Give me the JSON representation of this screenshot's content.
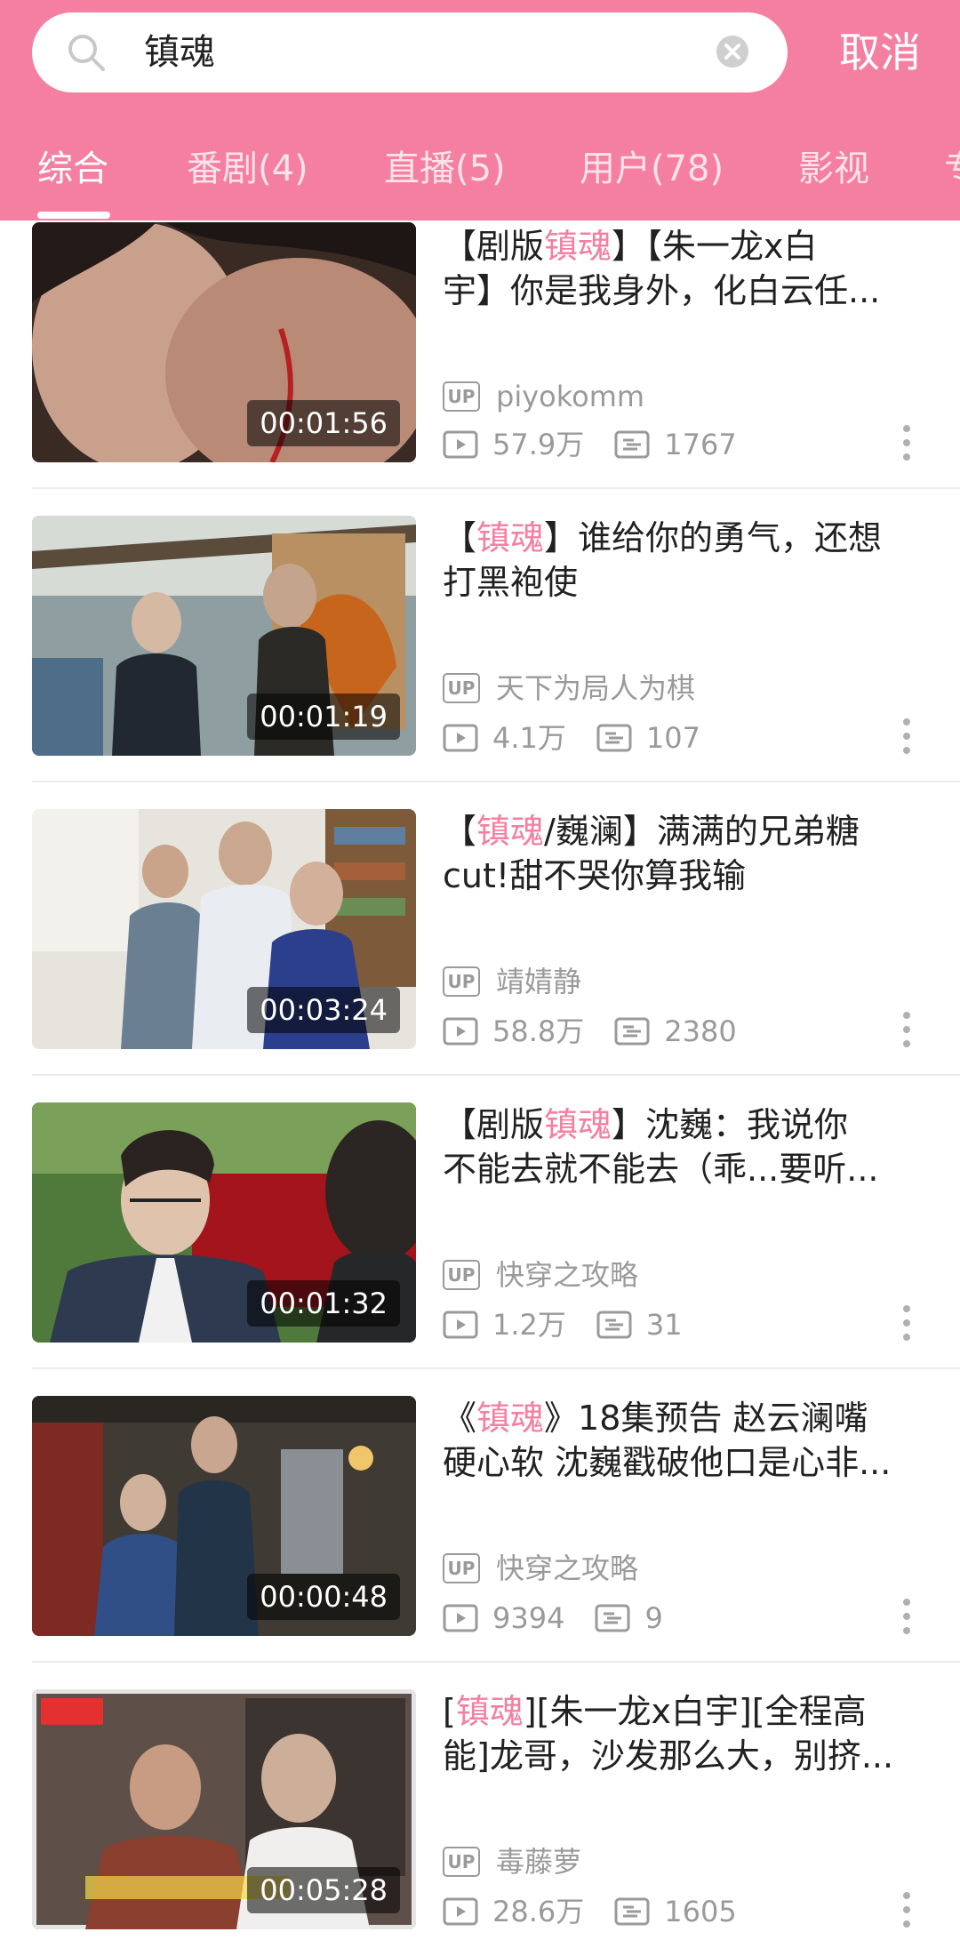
{
  "search": {
    "query": "镇魂",
    "cancel_label": "取消"
  },
  "tabs": [
    {
      "label": "综合",
      "active": true
    },
    {
      "label": "番剧(4)",
      "active": false
    },
    {
      "label": "直播(5)",
      "active": false
    },
    {
      "label": "用户(78)",
      "active": false
    },
    {
      "label": "影视",
      "active": false
    },
    {
      "label": "专",
      "active": false
    }
  ],
  "colors": {
    "accent": "#f57fa1",
    "highlight_text": "#f57fa1",
    "meta_text": "#9a9a9a"
  },
  "icons": {
    "search": "search-icon",
    "clear": "clear-icon",
    "play_count": "play-icon",
    "danmaku_count": "danmaku-icon",
    "more": "more-vertical-icon",
    "uploader": "up-badge-icon"
  },
  "up_badge_label": "UP",
  "videos": [
    {
      "title_line1": [
        "【剧版",
        "镇魂",
        "】【朱一龙x白"
      ],
      "title_line2": "宇】你是我身外，化白云任...",
      "uploader": "piyokomm",
      "plays": "57.9万",
      "danmaku": "1767",
      "duration": "00:01:56"
    },
    {
      "title_line1": [
        "【",
        "镇魂",
        "】谁给你的勇气，还想"
      ],
      "title_line2": "打黑袍使",
      "uploader": "天下为局人为棋",
      "plays": "4.1万",
      "danmaku": "107",
      "duration": "00:01:19"
    },
    {
      "title_line1": [
        "【",
        "镇魂",
        "/巍澜】满满的兄弟糖"
      ],
      "title_line2": "cut!甜不哭你算我输",
      "uploader": "靖婧静",
      "plays": "58.8万",
      "danmaku": "2380",
      "duration": "00:03:24"
    },
    {
      "title_line1": [
        "【剧版",
        "镇魂",
        "】沈巍：我说你"
      ],
      "title_line2": "不能去就不能去（乖...要听...",
      "uploader": "快穿之攻略",
      "plays": "1.2万",
      "danmaku": "31",
      "duration": "00:01:32"
    },
    {
      "title_line1": [
        "《",
        "镇魂",
        "》18集预告 赵云澜嘴"
      ],
      "title_line2": "硬心软 沈巍戳破他口是心非...",
      "uploader": "快穿之攻略",
      "plays": "9394",
      "danmaku": "9",
      "duration": "00:00:48"
    },
    {
      "title_line1": [
        "[",
        "镇魂",
        "][朱一龙x白宇][全程高"
      ],
      "title_line2": "能]龙哥，沙发那么大，别挤...",
      "uploader": "毒藤萝",
      "plays": "28.6万",
      "danmaku": "1605",
      "duration": "00:05:28"
    }
  ]
}
